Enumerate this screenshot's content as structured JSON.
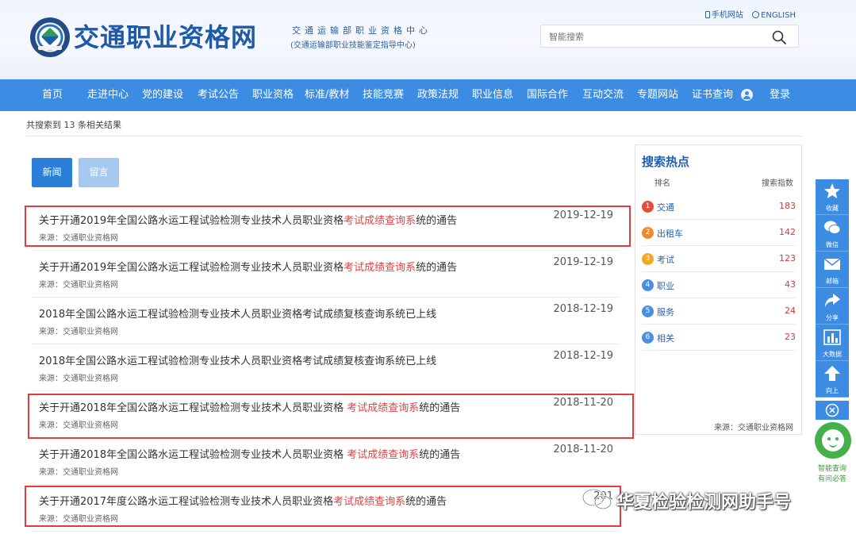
{
  "header": {
    "site_title": "交通职业资格网",
    "center_name": "交通运输部职业资格中心",
    "center_sub": "(交通运输部职业技能鉴定指导中心)",
    "mobile_link": "手机网站",
    "english_link": "ENGLISH",
    "search_placeholder": "智能搜索"
  },
  "nav": {
    "items": [
      {
        "label": "首页"
      },
      {
        "label": "走进中心"
      },
      {
        "label": "党的建设"
      },
      {
        "label": "考试公告"
      },
      {
        "label": "职业资格"
      },
      {
        "label": "标准/教材"
      },
      {
        "label": "技能竞赛"
      },
      {
        "label": "政策法规"
      },
      {
        "label": "职业信息"
      },
      {
        "label": "国际合作"
      },
      {
        "label": "互动交流"
      },
      {
        "label": "专题网站"
      },
      {
        "label": "证书查询"
      },
      {
        "label": "登录"
      }
    ]
  },
  "search": {
    "result_count_text": "共搜索到 13 条相关结果",
    "tabs": [
      {
        "label": "新闻"
      },
      {
        "label": "留言"
      }
    ]
  },
  "results": [
    {
      "title_pre": "关于开通2019年全国公路水运工程试验检测专业技术人员职业资格",
      "title_hl": "考试成绩查询系",
      "title_post": "统的通告",
      "source": "来源：交通职业资格网",
      "date": "2019-12-19"
    },
    {
      "title_pre": "关于开通2019年全国公路水运工程试验检测专业技术人员职业资格",
      "title_hl": "考试成绩查询系",
      "title_post": "统的通告",
      "source": "来源：交通职业资格网",
      "date": "2019-12-19"
    },
    {
      "title_pre": "2018年全国公路水运工程试验检测专业技术人员职业资格考试成绩复核查询系统已上线",
      "title_hl": "",
      "title_post": "",
      "source": "来源：交通职业资格网",
      "date": "2018-12-19"
    },
    {
      "title_pre": "2018年全国公路水运工程试验检测专业技术人员职业资格考试成绩复核查询系统已上线",
      "title_hl": "",
      "title_post": "",
      "source": "来源：交通职业资格网",
      "date": "2018-12-19"
    },
    {
      "title_pre": "关于开通2018年全国公路水运工程试验检测专业技术人员职业资格 ",
      "title_hl": "考试成绩查询系",
      "title_post": "统的通告",
      "source": "来源：交通职业资格网",
      "date": "2018-11-20"
    },
    {
      "title_pre": "关于开通2018年全国公路水运工程试验检测专业技术人员职业资格 ",
      "title_hl": "考试成绩查询系",
      "title_post": "统的通告",
      "source": "来源：交通职业资格网",
      "date": "2018-11-20"
    },
    {
      "title_pre": "关于开通2017年度公路水运工程试验检测专业技术人员职业资格",
      "title_hl": "考试成绩查询系",
      "title_post": "统的通告",
      "source": "来源：交通职业资格网",
      "date": "201"
    }
  ],
  "hot": {
    "title": "搜索热点",
    "col_rank": "排名",
    "col_index": "搜索指数",
    "items": [
      {
        "rank": "1",
        "word": "交通",
        "value": "183",
        "color": "#e84c3d"
      },
      {
        "rank": "2",
        "word": "出租车",
        "value": "142",
        "color": "#f08a24"
      },
      {
        "rank": "3",
        "word": "考试",
        "value": "123",
        "color": "#f5a623"
      },
      {
        "rank": "4",
        "word": "职业",
        "value": "43",
        "color": "#4a90e2"
      },
      {
        "rank": "5",
        "word": "服务",
        "value": "24",
        "color": "#4a90e2"
      },
      {
        "rank": "6",
        "word": "相关",
        "value": "23",
        "color": "#4a90e2"
      }
    ],
    "source": "来源：交通职业资格网"
  },
  "sidebar": {
    "favorite": "收藏",
    "wechat": "微信",
    "mail": "邮箱",
    "share": "分享",
    "bigdata": "大数据",
    "top": "向上",
    "assistant_line1": "智能查询",
    "assistant_line2": "有问必答"
  },
  "watermark": {
    "text": "华夏检验检测网助手号"
  }
}
